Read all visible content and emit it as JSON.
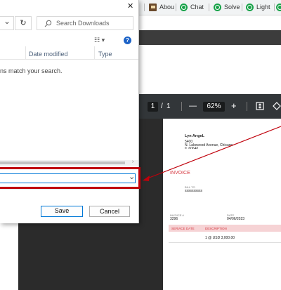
{
  "browser": {
    "tabs": [
      {
        "label": "Abou",
        "icon": "image-favicon-icon"
      },
      {
        "label": "Chat",
        "icon": "chatgpt-icon"
      },
      {
        "label": "Solve",
        "icon": "chatgpt-icon"
      },
      {
        "label": "Light",
        "icon": "chatgpt-icon"
      }
    ]
  },
  "dialog": {
    "close_glyph": "✕",
    "dropdown_glyph": "⌄",
    "refresh_glyph": "↻",
    "search_placeholder": "Search Downloads",
    "view_glyph": "☷ ▾",
    "help_glyph": "?",
    "columns": [
      "Date modified",
      "Type"
    ],
    "empty_message": "ns match your search.",
    "save_label": "Save",
    "cancel_label": "Cancel"
  },
  "pdf_viewer": {
    "page_current": "1",
    "page_separator": "/",
    "page_total": "1",
    "zoom_out": "—",
    "zoom_level": "62%",
    "zoom_in": "+"
  },
  "invoice": {
    "name": "Lyn AngeL",
    "address_line1": "5400",
    "address_line2": "N. Lakewood Avenue, Chicago",
    "address_line3": "IL 60640",
    "title": "INVOICE",
    "bill_to_label": "BILL TO",
    "bill_to_value": "ssssssssss",
    "invoice_no_label": "INVOICE #",
    "invoice_no": "3296",
    "date_label": "DATE",
    "date": "04/06/2023",
    "col_service_date": "SERVICE DATE",
    "col_description": "DESCRIPTION",
    "line_item": "1 @ USD 3,000.00"
  },
  "colors": {
    "highlight_red": "#c0000b",
    "invoice_red": "#d5353d",
    "table_header_bg": "#f6d3d5",
    "viewer_bg": "#323639"
  }
}
